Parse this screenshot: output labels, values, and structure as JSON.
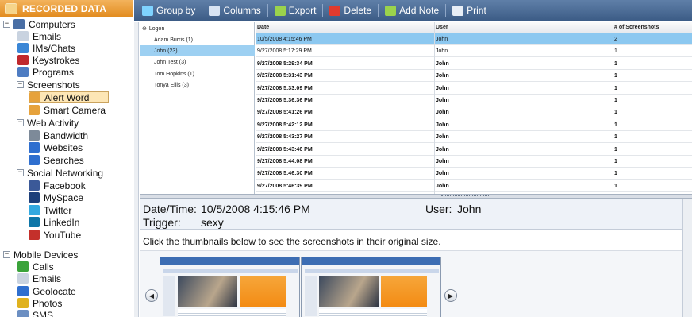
{
  "sidebar": {
    "header": "RECORDED DATA",
    "tree": [
      {
        "label": "Computers",
        "toggle": "−",
        "icon": "computer-icon",
        "color": "#4a6fa5"
      },
      {
        "label": "Emails",
        "icon": "envelope-icon",
        "color": "#c9d3e0"
      },
      {
        "label": "IMs/Chats",
        "icon": "chat-bubbles-icon",
        "color": "#3a86d6"
      },
      {
        "label": "Keystrokes",
        "icon": "keyboard-a-icon",
        "color": "#c0282d"
      },
      {
        "label": "Programs",
        "icon": "programs-grid-icon",
        "color": "#4e7cc2"
      },
      {
        "label": "Screenshots",
        "toggle": "−",
        "icon": "",
        "color": ""
      },
      {
        "label": "Alert Word",
        "icon": "photo-alert-icon",
        "color": "#e6a23c"
      },
      {
        "label": "Smart Camera",
        "icon": "photo-camera-icon",
        "color": "#e6a23c"
      },
      {
        "label": "Web Activity",
        "toggle": "−",
        "icon": "",
        "color": ""
      },
      {
        "label": "Bandwidth",
        "icon": "bandwidth-gauge-icon",
        "color": "#7d8a99"
      },
      {
        "label": "Websites",
        "icon": "globe-icon",
        "color": "#2f6fcf"
      },
      {
        "label": "Searches",
        "icon": "globe-search-icon",
        "color": "#2f6fcf"
      },
      {
        "label": "Social Networking",
        "toggle": "−",
        "icon": "",
        "color": ""
      },
      {
        "label": "Facebook",
        "icon": "facebook-icon",
        "color": "#3b5998"
      },
      {
        "label": "MySpace",
        "icon": "myspace-icon",
        "color": "#1d3f7a"
      },
      {
        "label": "Twitter",
        "icon": "twitter-bird-icon",
        "color": "#33a9e0"
      },
      {
        "label": "LinkedIn",
        "icon": "linkedin-icon",
        "color": "#0e76a8"
      },
      {
        "label": "YouTube",
        "icon": "youtube-icon",
        "color": "#c4302b"
      },
      {
        "label": "Mobile Devices",
        "toggle": "−",
        "icon": "",
        "color": ""
      },
      {
        "label": "Calls",
        "icon": "phone-icon",
        "color": "#3aa33a"
      },
      {
        "label": "Emails",
        "icon": "envelope-icon",
        "color": "#c9d3e0"
      },
      {
        "label": "Geolocate",
        "icon": "globe-pin-icon",
        "color": "#2f6fcf"
      },
      {
        "label": "Photos",
        "icon": "sunflower-photo-icon",
        "color": "#e0b21e"
      },
      {
        "label": "SMS",
        "icon": "sms-icon",
        "color": "#6c8fc2"
      }
    ]
  },
  "toolbar": {
    "buttons": [
      {
        "label": "Group by",
        "icon": "group-by-icon",
        "color": "#7fd3ff"
      },
      {
        "label": "Columns",
        "icon": "columns-icon",
        "color": "#d7e3f2"
      },
      {
        "label": "Export",
        "icon": "export-icon",
        "color": "#9bd34c"
      },
      {
        "label": "Delete",
        "icon": "delete-x-icon",
        "color": "#e23b2e"
      },
      {
        "label": "Add Note",
        "icon": "add-note-icon",
        "color": "#9bd34c"
      },
      {
        "label": "Print",
        "icon": "printer-icon",
        "color": "#e8eef6"
      }
    ]
  },
  "logon": {
    "header": "Logon",
    "items": [
      "Adam Burris (1)",
      "John (23)",
      "John Test (3)",
      "Tom Hopkins (1)",
      "Tonya Ellis (3)"
    ]
  },
  "grid": {
    "columns": [
      "Date",
      "User",
      "# of Screenshots"
    ],
    "rows": [
      [
        "10/5/2008 4:15:46 PM",
        "John",
        "2"
      ],
      [
        "9/27/2008 5:17:29 PM",
        "John",
        "1"
      ],
      [
        "9/27/2008 5:29:34 PM",
        "John",
        "1"
      ],
      [
        "9/27/2008 5:31:43 PM",
        "John",
        "1"
      ],
      [
        "9/27/2008 5:33:09 PM",
        "John",
        "1"
      ],
      [
        "9/27/2008 5:36:36 PM",
        "John",
        "1"
      ],
      [
        "9/27/2008 5:41:26 PM",
        "John",
        "1"
      ],
      [
        "9/27/2008 5:42:12 PM",
        "John",
        "1"
      ],
      [
        "9/27/2008 5:43:27 PM",
        "John",
        "1"
      ],
      [
        "9/27/2008 5:43:46 PM",
        "John",
        "1"
      ],
      [
        "9/27/2008 5:44:08 PM",
        "John",
        "1"
      ],
      [
        "9/27/2008 5:46:30 PM",
        "John",
        "1"
      ],
      [
        "9/27/2008 5:46:39 PM",
        "John",
        "1"
      ]
    ]
  },
  "detail": {
    "datetime_label": "Date/Time:",
    "datetime_value": "10/5/2008 4:15:46 PM",
    "trigger_label": "Trigger:",
    "trigger_value": "sexy",
    "user_label": "User:",
    "user_value": "John",
    "instruction": "Click the thumbnails below to see the screenshots in their original size."
  }
}
